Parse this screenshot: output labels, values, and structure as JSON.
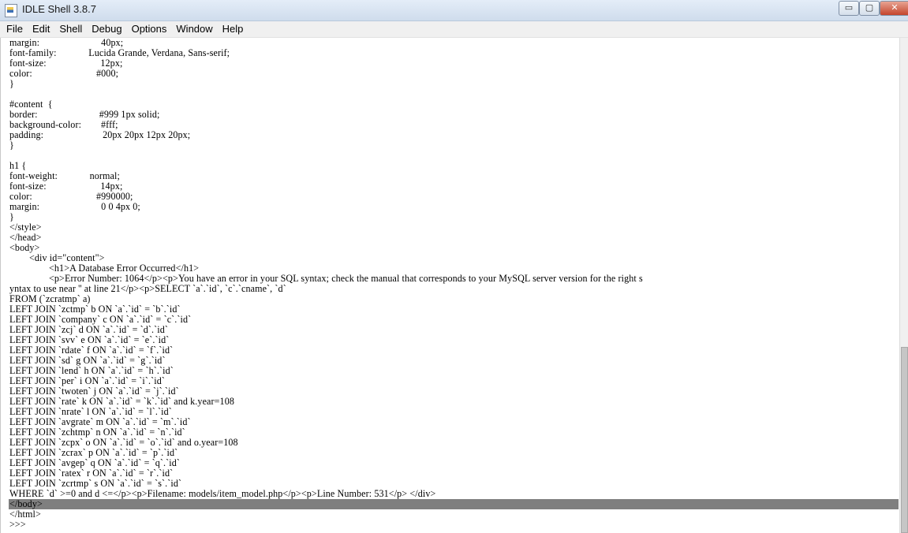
{
  "window": {
    "title": "IDLE Shell 3.8.7",
    "buttons": {
      "minimize": "▭",
      "maximize": "▢",
      "close": "✕"
    }
  },
  "menu": {
    "items": [
      "File",
      "Edit",
      "Shell",
      "Debug",
      "Options",
      "Window",
      "Help"
    ]
  },
  "shell": {
    "selected_line_index": 45,
    "lines": [
      "margin:                         40px;",
      "font-family:             Lucida Grande, Verdana, Sans-serif;",
      "font-size:                      12px;",
      "color:                          #000;",
      "}",
      "",
      "#content  {",
      "border:                         #999 1px solid;",
      "background-color:        #fff;",
      "padding:                        20px 20px 12px 20px;",
      "}",
      "",
      "h1 {",
      "font-weight:             normal;",
      "font-size:                      14px;",
      "color:                          #990000;",
      "margin:                         0 0 4px 0;",
      "}",
      "</style>",
      "</head>",
      "<body>",
      "        <div id=\"content\">",
      "                <h1>A Database Error Occurred</h1>",
      "                <p>Error Number: 1064</p><p>You have an error in your SQL syntax; check the manual that corresponds to your MySQL server version for the right s",
      "yntax to use near '' at line 21</p><p>SELECT `a`.`id`, `c`.`cname`, `d`",
      "FROM (`zcratmp` a)",
      "LEFT JOIN `zctmp` b ON `a`.`id` = `b`.`id`",
      "LEFT JOIN `company` c ON `a`.`id` = `c`.`id`",
      "LEFT JOIN `zcj` d ON `a`.`id` = `d`.`id`",
      "LEFT JOIN `svv` e ON `a`.`id` = `e`.`id`",
      "LEFT JOIN `rdate` f ON `a`.`id` = `f`.`id`",
      "LEFT JOIN `sd` g ON `a`.`id` = `g`.`id`",
      "LEFT JOIN `lend` h ON `a`.`id` = `h`.`id`",
      "LEFT JOIN `per` i ON `a`.`id` = `i`.`id`",
      "LEFT JOIN `twoten` j ON `a`.`id` = `j`.`id`",
      "LEFT JOIN `rate` k ON `a`.`id` = `k`.`id` and k.year=108",
      "LEFT JOIN `nrate` l ON `a`.`id` = `l`.`id`",
      "LEFT JOIN `avgrate` m ON `a`.`id` = `m`.`id`",
      "LEFT JOIN `zchtmp` n ON `a`.`id` = `n`.`id`",
      "LEFT JOIN `zcpx` o ON `a`.`id` = `o`.`id` and o.year=108",
      "LEFT JOIN `zcrax` p ON `a`.`id` = `p`.`id`",
      "LEFT JOIN `avgep` q ON `a`.`id` = `q`.`id`",
      "LEFT JOIN `ratex` r ON `a`.`id` = `r`.`id`",
      "LEFT JOIN `zcrtmp` s ON `a`.`id` = `s`.`id`",
      "WHERE `d` >=0 and d <=</p><p>Filename: models/item_model.php</p><p>Line Number: 531</p> </div>",
      "</body>",
      "</html>",
      ">>> "
    ]
  }
}
